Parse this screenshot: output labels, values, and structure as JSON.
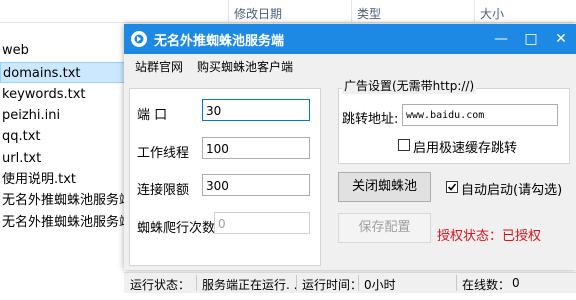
{
  "explorer": {
    "columns": [
      "修改日期",
      "类型",
      "大小"
    ],
    "files": [
      "web",
      "domains.txt",
      "keywords.txt",
      "peizhi.ini",
      "qq.txt",
      "url.txt",
      "使用说明.txt",
      "无名外推蜘蛛池服务端V",
      "无名外推蜘蛛池服务端"
    ]
  },
  "window": {
    "title": "无名外推蜘蛛池服务端",
    "controls": {
      "minimize": "—",
      "maximize": "□",
      "close": "✕"
    }
  },
  "menu": [
    "站群官网",
    "购买蜘蛛池客户端"
  ],
  "form": {
    "port": {
      "label": "端    口",
      "value": "30"
    },
    "threads": {
      "label": "工作线程",
      "value": "100"
    },
    "limit": {
      "label": "连接限额",
      "value": "300"
    },
    "crawl": {
      "label": "蜘蛛爬行次数",
      "value": "0"
    }
  },
  "ad": {
    "title": "广告设置(无需带http://)",
    "redirect_label": "跳转地址:",
    "redirect_value": "www.baidu.com",
    "cache_label": "启用极速缓存跳转"
  },
  "buttons": {
    "close_pool": "关闭蜘蛛池",
    "save_config": "保存配置",
    "autostart": "自动启动(请勾选)"
  },
  "auth_status": "授权状态：已授权",
  "statusbar": {
    "run_label": "运行状态：",
    "run_value": "服务端正在运行. .",
    "time_label": "运行时间：",
    "time_value": "0小时",
    "online_label": "在线数：",
    "online_value": "0"
  },
  "colors": {
    "titlebar": "#1e88e5",
    "auth_status": "#d4141a"
  }
}
